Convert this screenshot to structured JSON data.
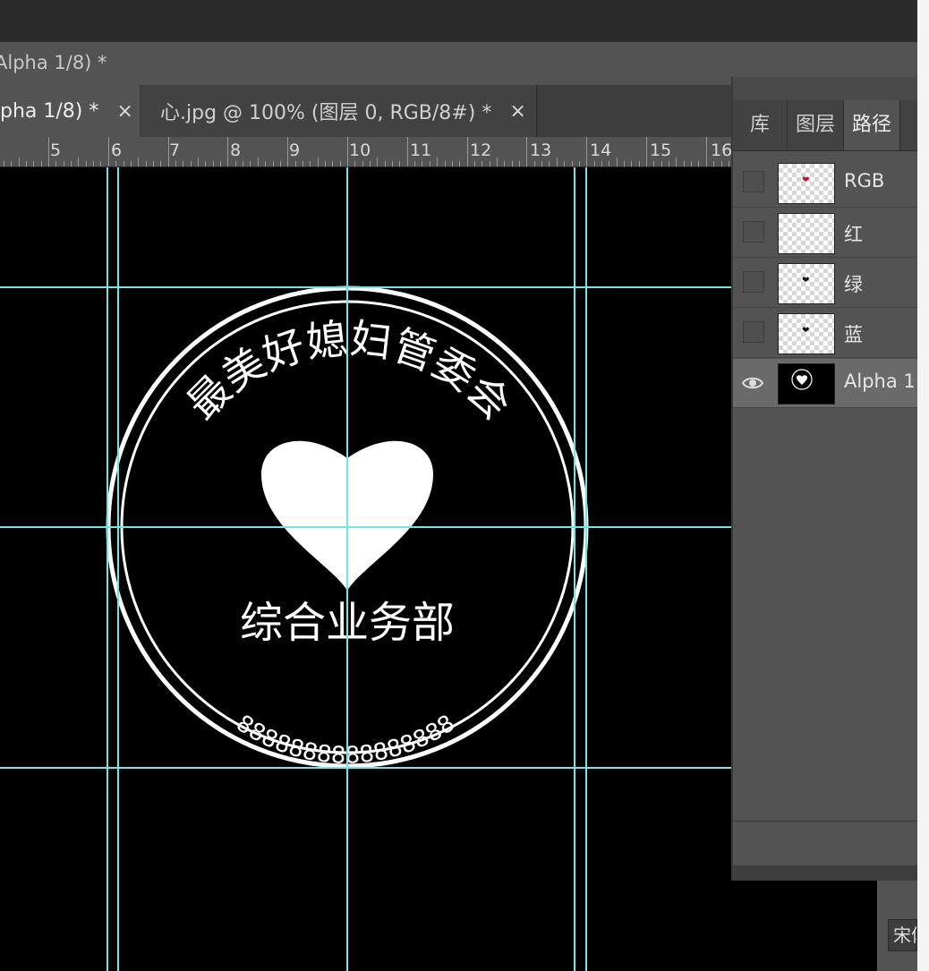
{
  "window": {
    "title": "Alpha 1/8) *"
  },
  "tabs": [
    {
      "label": "pha 1/8) *",
      "close": "×",
      "active": true
    },
    {
      "label": "心.jpg @ 100% (图层 0, RGB/8#) *",
      "close": "×",
      "active": false
    }
  ],
  "ruler": {
    "labels": [
      "5",
      "6",
      "7",
      "8",
      "9",
      "10",
      "11",
      "12",
      "13",
      "14",
      "15",
      "16"
    ]
  },
  "seal": {
    "top_text": "最美好媳妇管委会",
    "middle_text": "综合业务部",
    "bottom_text": "8888888888888888",
    "colors": {
      "seal": "#ffffff",
      "background": "#000000",
      "guide": "#6fe6ec"
    }
  },
  "panel": {
    "tabs": [
      {
        "label": "库"
      },
      {
        "label": "图层"
      },
      {
        "label": "路径"
      }
    ],
    "channels": [
      {
        "name": "RGB",
        "visible": false,
        "thumb_dot": "❤",
        "dot_color": "#c0121c",
        "selected": false
      },
      {
        "name": "红",
        "visible": false,
        "thumb_dot": "",
        "dot_color": "#000000",
        "selected": false
      },
      {
        "name": "绿",
        "visible": false,
        "thumb_dot": "❤",
        "dot_color": "#111111",
        "selected": false
      },
      {
        "name": "蓝",
        "visible": false,
        "thumb_dot": "❤",
        "dot_color": "#111111",
        "selected": false
      },
      {
        "name": "Alpha 1",
        "visible": true,
        "thumb_dot": "❤",
        "dot_color": "#ffffff",
        "selected": true
      }
    ]
  },
  "font_field": {
    "value": "宋体"
  },
  "icons": {
    "visibility": "eye-icon",
    "close": "close-icon"
  }
}
